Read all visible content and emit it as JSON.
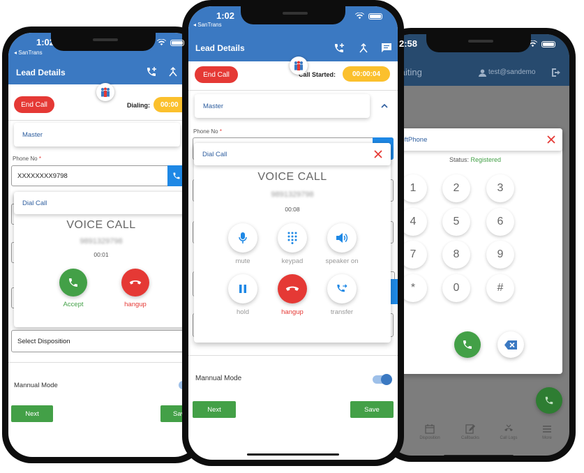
{
  "status": {
    "time": "1:02",
    "carrier": "◂ SanTrans",
    "time_right": "2:58"
  },
  "lead": {
    "title": "Lead Details",
    "end_call": "End Call",
    "dialing_label": "Dialing:",
    "dialing_timer": "00:00",
    "call_started_label": "Call Started:",
    "call_timer": "00:00:04",
    "master": "Master",
    "phone_label": "Phone No",
    "required_mark": "*",
    "phone_value": "XXXXXXXX9798",
    "select_disposition": "Select Disposition",
    "manual_mode": "Mannual Mode",
    "next": "Next",
    "save": "Save",
    "save_cut": "Sav"
  },
  "incoming": {
    "header": "Dial Call",
    "title": "VOICE CALL",
    "number": "9891329798",
    "timer": "00:01",
    "accept": "Accept",
    "hangup": "hangup"
  },
  "active": {
    "header": "Dial Call",
    "title": "VOICE CALL",
    "number": "9891329798",
    "timer": "00:08",
    "controls": [
      {
        "label": "mute",
        "icon": "mic-icon"
      },
      {
        "label": "keypad",
        "icon": "keypad-icon"
      },
      {
        "label": "speaker on",
        "icon": "speaker-icon"
      },
      {
        "label": "hold",
        "icon": "pause-icon"
      },
      {
        "label": "hangup",
        "icon": "hangup-icon"
      },
      {
        "label": "transfer",
        "icon": "transfer-icon"
      }
    ]
  },
  "softphone": {
    "waiting": "Waiting",
    "user": "test@sandemo",
    "title": "SoftPhone",
    "status_label": "Status:",
    "status_value": "Registered",
    "keys": [
      "1",
      "2",
      "3",
      "4",
      "5",
      "6",
      "7",
      "8",
      "9",
      "*",
      "0",
      "#"
    ],
    "tabs": [
      "Disposition",
      "Callbacks",
      "Call Logs",
      "More"
    ]
  },
  "colors": {
    "primary": "#3b79c2",
    "danger": "#e53935",
    "success": "#43a047",
    "warning": "#fbc02d"
  }
}
